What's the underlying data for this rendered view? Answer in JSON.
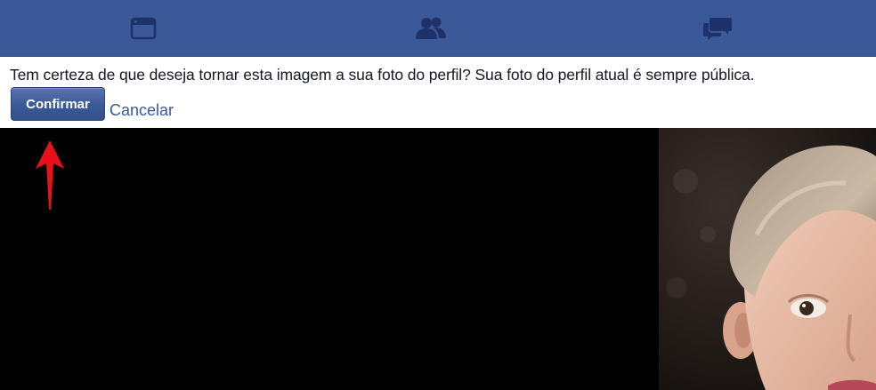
{
  "nav": {
    "items": [
      {
        "icon": "newsfeed-icon"
      },
      {
        "icon": "friends-icon"
      },
      {
        "icon": "messages-icon"
      }
    ]
  },
  "prompt": {
    "text": "Tem certeza de que deseja tornar esta imagem a sua foto do perfil? Sua foto do perfil atual é sempre pública.",
    "confirm_label": "Confirmar",
    "cancel_label": "Cancelar"
  },
  "colors": {
    "brand": "#3b5998",
    "annotation_arrow": "#e8111b"
  }
}
